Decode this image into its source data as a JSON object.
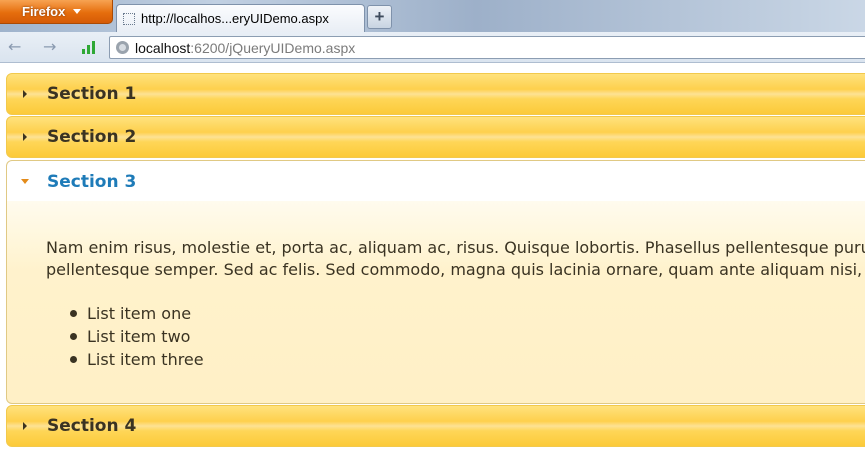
{
  "browser": {
    "menu_button": "Firefox",
    "tab_title": "http://localhos...eryUIDemo.aspx",
    "new_tab_label": "+",
    "url_host": "localhost",
    "url_rest": ":6200/jQueryUIDemo.aspx"
  },
  "accordion": {
    "sections": [
      {
        "title": "Section 1",
        "active": false
      },
      {
        "title": "Section 2",
        "active": false
      },
      {
        "title": "Section 3",
        "active": true
      },
      {
        "title": "Section 4",
        "active": false
      }
    ],
    "content": {
      "line1": "Nam enim risus, molestie et, porta ac, aliquam ac, risus. Quisque lobortis. Phasellus pellentesque purus i",
      "line2": "pellentesque semper. Sed ac felis. Sed commodo, magna quis lacinia ornare, quam ante aliquam nisi, eu",
      "list_items": [
        "List item one",
        "List item two",
        "List item three"
      ]
    }
  },
  "colors": {
    "header_gold": "#fed04d",
    "active_title": "#1e7bb8",
    "content_bg": "#fff2cc",
    "firefox_orange": "#e66e0d"
  },
  "icons": {
    "closed_section": "triangle-right-icon",
    "open_section": "triangle-down-icon",
    "back": "back-arrow-icon",
    "forward": "forward-arrow-icon",
    "site": "globe-icon"
  }
}
